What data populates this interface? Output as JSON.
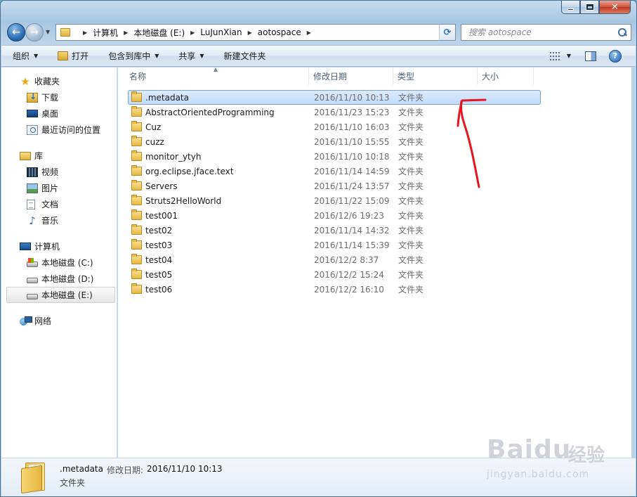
{
  "address": {
    "crumbs": [
      "计算机",
      "本地磁盘 (E:)",
      "LuJunXian",
      "aotospace"
    ]
  },
  "search": {
    "placeholder": "搜索 aotospace"
  },
  "toolbar": {
    "organize": "组织",
    "open": "打开",
    "include_in_library": "包含到库中",
    "share": "共享",
    "new_folder": "新建文件夹",
    "help": "?"
  },
  "sidebar": {
    "favorites": {
      "label": "收藏夹",
      "items": [
        {
          "label": "下载",
          "icon": "download-folder-icon"
        },
        {
          "label": "桌面",
          "icon": "desktop-icon"
        },
        {
          "label": "最近访问的位置",
          "icon": "recent-places-icon"
        }
      ]
    },
    "libraries": {
      "label": "库",
      "items": [
        {
          "label": "视频",
          "icon": "video-icon"
        },
        {
          "label": "图片",
          "icon": "pictures-icon"
        },
        {
          "label": "文档",
          "icon": "documents-icon"
        },
        {
          "label": "音乐",
          "icon": "music-icon"
        }
      ]
    },
    "computer": {
      "label": "计算机",
      "items": [
        {
          "label": "本地磁盘 (C:)",
          "icon": "system-drive-icon"
        },
        {
          "label": "本地磁盘 (D:)",
          "icon": "drive-icon"
        },
        {
          "label": "本地磁盘 (E:)",
          "icon": "drive-icon",
          "selected": true
        }
      ]
    },
    "network": {
      "label": "网络"
    }
  },
  "columns": {
    "name": "名称",
    "date": "修改日期",
    "type": "类型",
    "size": "大小"
  },
  "files": [
    {
      "name": ".metadata",
      "date": "2016/11/10 10:13",
      "type": "文件夹",
      "selected": true
    },
    {
      "name": "AbstractOrientedProgramming",
      "date": "2016/11/23 15:23",
      "type": "文件夹"
    },
    {
      "name": "Cuz",
      "date": "2016/11/10 16:03",
      "type": "文件夹"
    },
    {
      "name": "cuzz",
      "date": "2016/11/10 15:55",
      "type": "文件夹"
    },
    {
      "name": "monitor_ytyh",
      "date": "2016/11/10 10:18",
      "type": "文件夹"
    },
    {
      "name": "org.eclipse.jface.text",
      "date": "2016/11/14 14:59",
      "type": "文件夹"
    },
    {
      "name": "Servers",
      "date": "2016/11/24 13:57",
      "type": "文件夹"
    },
    {
      "name": "Struts2HelloWorld",
      "date": "2016/11/22 15:09",
      "type": "文件夹"
    },
    {
      "name": "test001",
      "date": "2016/12/6 19:23",
      "type": "文件夹"
    },
    {
      "name": "test02",
      "date": "2016/11/14 14:32",
      "type": "文件夹"
    },
    {
      "name": "test03",
      "date": "2016/11/14 15:39",
      "type": "文件夹"
    },
    {
      "name": "test04",
      "date": "2016/12/2 8:37",
      "type": "文件夹"
    },
    {
      "name": "test05",
      "date": "2016/12/2 15:24",
      "type": "文件夹"
    },
    {
      "name": "test06",
      "date": "2016/12/2 16:10",
      "type": "文件夹"
    }
  ],
  "details": {
    "name": ".metadata",
    "modified_label": "修改日期:",
    "modified_value": "2016/11/10 10:13",
    "type": "文件夹"
  },
  "watermark": {
    "logo": "Baidu",
    "cn": "经验",
    "url": "jingyan.baidu.com"
  },
  "colors": {
    "annotation": "#e8141e",
    "selection": "#c1dcfc"
  }
}
